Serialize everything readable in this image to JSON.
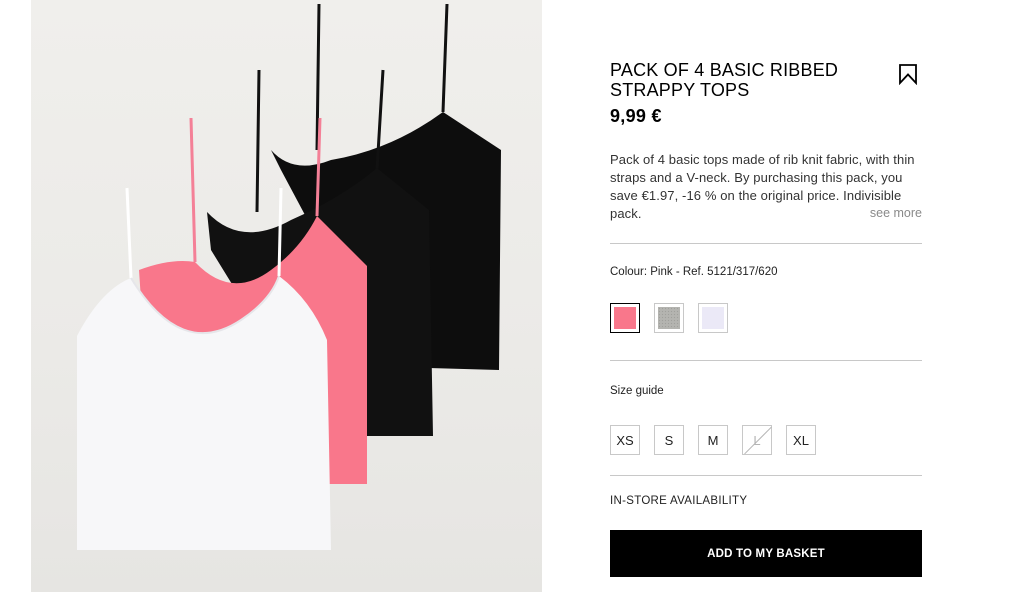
{
  "product": {
    "title": "PACK OF 4 BASIC RIBBED STRAPPY TOPS",
    "price": "9,99 €",
    "description": "Pack of 4 basic tops made of rib knit fabric, with thin straps and a V-neck. By purchasing this pack, you save €1.97, -16 % on the original price. Indivisible pack.",
    "see_more": "see more",
    "bookmark_icon": "bookmark-icon"
  },
  "colour": {
    "label": "Colour: Pink - Ref. 5121/317/620",
    "swatches": [
      {
        "name": "pink",
        "color": "#f9778b",
        "selected": true
      },
      {
        "name": "grey-marl",
        "color": "#b4b4b0",
        "selected": false
      },
      {
        "name": "lilac",
        "color": "#ebe9f7",
        "selected": false
      }
    ]
  },
  "size": {
    "label": "Size guide",
    "options": [
      {
        "label": "XS",
        "available": true
      },
      {
        "label": "S",
        "available": true
      },
      {
        "label": "M",
        "available": true
      },
      {
        "label": "L",
        "available": false
      },
      {
        "label": "XL",
        "available": true
      }
    ]
  },
  "availability": {
    "label": "IN-STORE AVAILABILITY"
  },
  "cta": {
    "label": "ADD TO MY BASKET"
  },
  "image": {
    "tops": [
      {
        "name": "black-top-back",
        "color": "#0d0d0d"
      },
      {
        "name": "black-top-front",
        "color": "#111111"
      },
      {
        "name": "pink-top",
        "color": "#f9778b"
      },
      {
        "name": "white-top",
        "color": "#f7f7f9"
      }
    ]
  }
}
